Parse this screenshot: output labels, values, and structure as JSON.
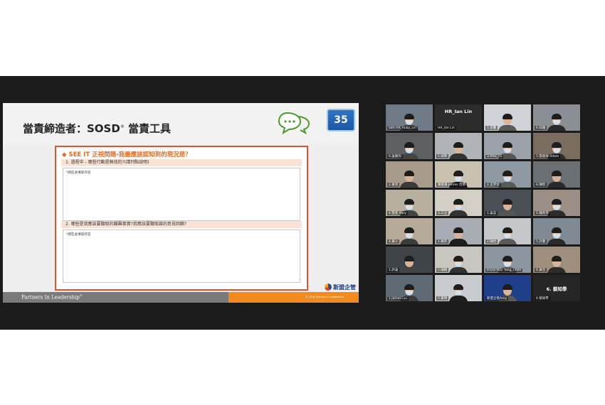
{
  "slide": {
    "title": "當責締造者：SOSD",
    "title_mark": "®",
    "title_suffix": " 當責工具",
    "page_number": "35",
    "heading": "◆  SEE IT 正視問題-我最應該認知到的現況是？",
    "q1": "1.  過程中 - 哪些行動是無效的?(請列點說明)",
    "q1_hint": "*請在此填寫作答",
    "q2": "2.  哪些是我應該要聽取的艱難事實?我應該要聽取誰的意見回饋?",
    "q2_hint": "*請在此填寫作答",
    "footer_left": "Partners In Leadership",
    "footer_left_mark": "®",
    "footer_copy": "© 2018 Partners In Leadership",
    "logo_text": "斯盟企管",
    "colors": {
      "accent": "#e2522c",
      "badge": "#2a6fc4",
      "footer_orange": "#f28a1e"
    }
  },
  "participants": [
    {
      "name": "Site HR_Ruby_Lin"
    },
    {
      "name": "HR_Ian Lin",
      "big": true
    },
    {
      "name": "5.芸馨"
    },
    {
      "name": "6.莉雅"
    },
    {
      "name": "6.吳佩均"
    },
    {
      "name": "5.胡俐"
    },
    {
      "name": "3.Alex_Fu"
    },
    {
      "name": "5.張俊祥 Adam"
    },
    {
      "name": "2.黃羽"
    },
    {
      "name": "陳俊鋒 James 范慈"
    },
    {
      "name": "2.王宇文"
    },
    {
      "name": "6.陳智"
    },
    {
      "name": "4.張進 Rory"
    },
    {
      "name": "3.三之"
    },
    {
      "name": "1.吳志"
    },
    {
      "name": "1.陳英杰"
    },
    {
      "name": "4.黃十"
    },
    {
      "name": "1.賴宗"
    },
    {
      "name": "2.陳怡"
    },
    {
      "name": "5.許豐"
    },
    {
      "name": "1.許凌"
    },
    {
      "name": "2.陳婕"
    },
    {
      "name": "4.EID PD2 Yang_Chen"
    },
    {
      "name": "6.黃佳"
    },
    {
      "name": "1.James Liu"
    },
    {
      "name": "5.黃明"
    },
    {
      "name": "斯盟企管Amy"
    },
    {
      "name": "6.蔡知學",
      "big": true,
      "big_label": "6. 蔡知學"
    }
  ]
}
